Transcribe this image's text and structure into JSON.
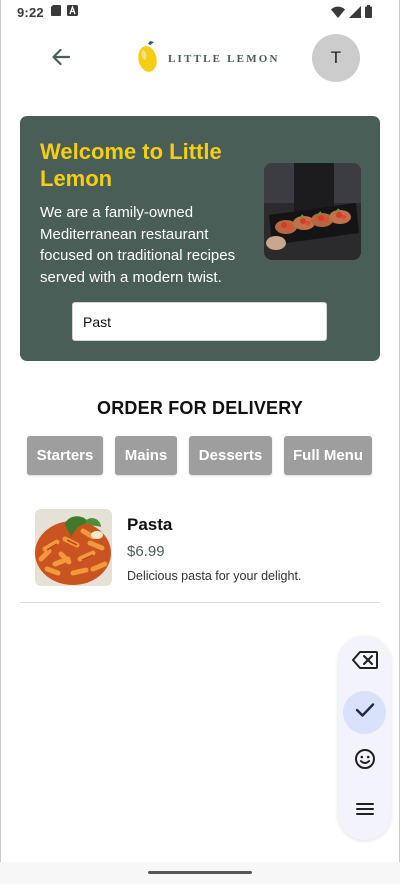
{
  "status_bar": {
    "time": "9:22",
    "left_icons": [
      "sd-card-icon",
      "notification-a-icon"
    ],
    "right_icons": [
      "wifi-icon",
      "signal-icon",
      "battery-icon"
    ]
  },
  "header": {
    "logo_text": "LITTLE LEMON",
    "avatar_initial": "T"
  },
  "hero": {
    "title": "Welcome to Little Lemon",
    "description": "We are a family-owned Mediterranean restaurant focused on traditional recipes served with a modern twist.",
    "search_value": "Past",
    "search_placeholder": ""
  },
  "order": {
    "title": "ORDER FOR DELIVERY",
    "categories": [
      "Starters",
      "Mains",
      "Desserts",
      "Full Menu"
    ]
  },
  "menu_items": [
    {
      "name": "Pasta",
      "price": "$6.99",
      "description": "Delicious pasta for your delight."
    }
  ],
  "keyboard_toolbar": {
    "buttons": [
      "backspace-icon",
      "check-icon",
      "emoji-icon",
      "menu-icon"
    ]
  },
  "colors": {
    "brand_green": "#495e57",
    "brand_yellow": "#f4ce14",
    "category_gray": "#9e9e9e",
    "toolbar_active": "#d9e1fb"
  }
}
